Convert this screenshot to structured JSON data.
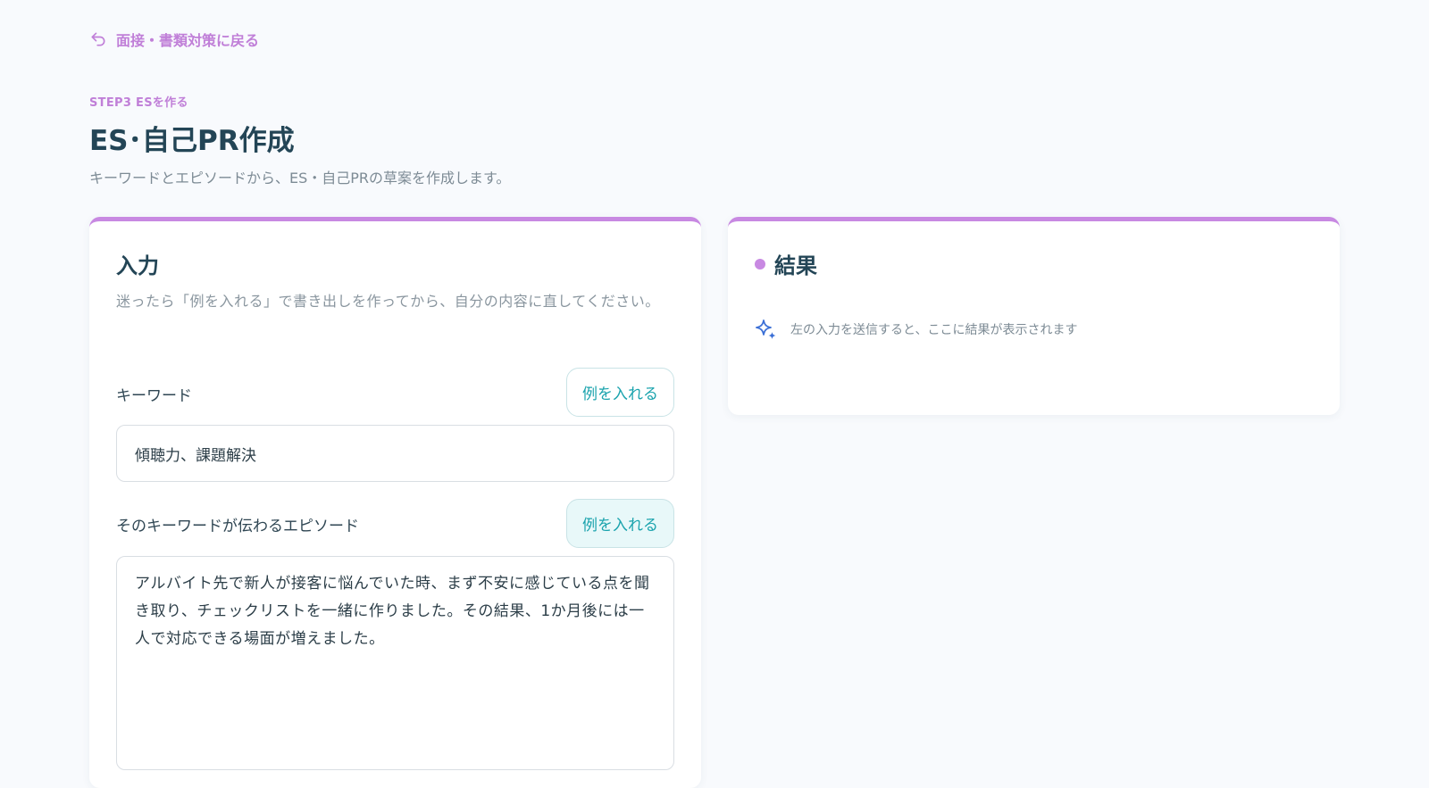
{
  "nav": {
    "back_label": "面接・書類対策に戻る"
  },
  "header": {
    "step_label": "STEP3 ESを作る",
    "title": "ES･自己PR作成",
    "description": "キーワードとエピソードから、ES・自己PRの草案を作成します。"
  },
  "input_card": {
    "title": "入力",
    "hint": "迷ったら「例を入れる」で書き出しを作ってから、自分の内容に直してください。",
    "keyword": {
      "label": "キーワード",
      "example_button": "例を入れる",
      "value": "傾聴力、課題解決"
    },
    "episode": {
      "label": "そのキーワードが伝わるエピソード",
      "example_button": "例を入れる",
      "value": "アルバイト先で新人が接客に悩んでいた時、まず不安に感じている点を聞き取り、チェックリストを一緒に作りました。その結果、1か月後には一人で対応できる場面が増えました。"
    }
  },
  "result_card": {
    "title": "結果",
    "empty_message": "左の入力を送信すると、ここに結果が表示されます"
  },
  "colors": {
    "accent_purple": "#c889e2",
    "accent_teal": "#1aa3ad",
    "sparkle_blue": "#3b6fd6"
  },
  "icons": {
    "back": "return-arrow-icon",
    "result_empty": "sparkle-icon"
  }
}
